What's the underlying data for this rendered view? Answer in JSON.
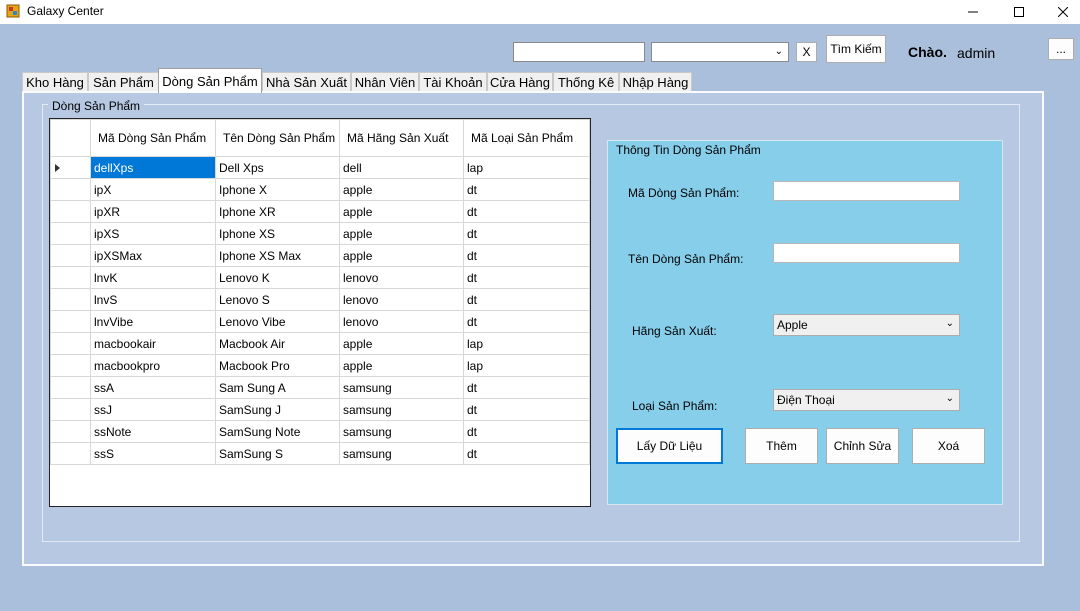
{
  "window": {
    "title": "Galaxy Center",
    "minimize_icon": "minimize-icon",
    "maximize_icon": "maximize-icon",
    "close_icon": "close-icon"
  },
  "toolbar": {
    "search_value": "",
    "combo_value": "",
    "clear_label": "X",
    "search_label": "Tìm Kiếm",
    "greeting": "Chào.",
    "username": "admin",
    "more_label": "..."
  },
  "tabs": [
    {
      "label": "Kho Hàng",
      "active": false
    },
    {
      "label": "Sản Phẩm",
      "active": false
    },
    {
      "label": "Dòng Sản Phẩm",
      "active": true
    },
    {
      "label": "Nhà Sản Xuất",
      "active": false
    },
    {
      "label": "Nhân Viên",
      "active": false
    },
    {
      "label": "Tài Khoản",
      "active": false
    },
    {
      "label": "Cửa Hàng",
      "active": false
    },
    {
      "label": "Thống Kê",
      "active": false
    },
    {
      "label": "Nhập Hàng",
      "active": false
    }
  ],
  "group_title": "Dòng Sản Phẩm",
  "grid": {
    "columns": [
      "Mã Dòng Sản Phẩm",
      "Tên Dòng Sản Phẩm",
      "Mã Hãng Sản Xuất",
      "Mã Loại Sản Phẩm"
    ],
    "rows": [
      [
        "dellXps",
        "Dell Xps",
        "dell",
        "lap"
      ],
      [
        "ipX",
        "Iphone X",
        "apple",
        "dt"
      ],
      [
        "ipXR",
        "Iphone XR",
        "apple",
        "dt"
      ],
      [
        "ipXS",
        "Iphone XS",
        "apple",
        "dt"
      ],
      [
        "ipXSMax",
        "Iphone XS Max",
        "apple",
        "dt"
      ],
      [
        "lnvK",
        "Lenovo K",
        "lenovo",
        "dt"
      ],
      [
        "lnvS",
        "Lenovo S",
        "lenovo",
        "dt"
      ],
      [
        "lnvVibe",
        "Lenovo Vibe",
        "lenovo",
        "dt"
      ],
      [
        "macbookair",
        "Macbook Air",
        "apple",
        "lap"
      ],
      [
        "macbookpro",
        "Macbook Pro",
        "apple",
        "lap"
      ],
      [
        "ssA",
        "Sam Sung A",
        "samsung",
        "dt"
      ],
      [
        "ssJ",
        "SamSung J",
        "samsung",
        "dt"
      ],
      [
        "ssNote",
        "SamSung Note",
        "samsung",
        "dt"
      ],
      [
        "ssS",
        "SamSung S",
        "samsung",
        "dt"
      ]
    ],
    "selected_row": 0,
    "current_row_icon": "row-pointer-icon"
  },
  "info": {
    "title": "Thông Tin Dòng Sản Phẩm",
    "ma_label": "Mã Dòng Sản Phẩm:",
    "ma_value": "",
    "ten_label": "Tên Dòng Sản Phẩm:",
    "ten_value": "",
    "hang_label": "Hãng Sản Xuất:",
    "hang_value": "Apple",
    "loai_label": "Loại Sản Phẩm:",
    "loai_value": "Điện Thoại"
  },
  "actions": {
    "load_label": "Lấy Dữ Liệu",
    "add_label": "Thêm",
    "edit_label": "Chỉnh Sửa",
    "delete_label": "Xoá"
  },
  "colors": {
    "background": "#a9bfdc",
    "panel": "#87ceeb",
    "selection": "#0078d7"
  }
}
